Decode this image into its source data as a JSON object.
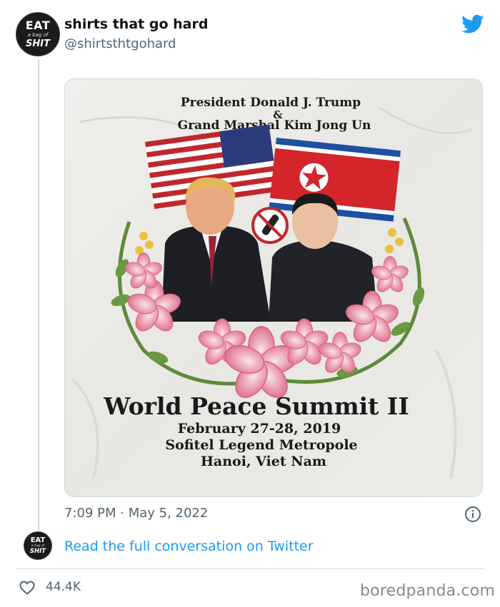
{
  "tweet": {
    "display_name": "shirts that go hard",
    "handle": "@shirtsthtgohard",
    "avatar_text": {
      "line1": "EAT",
      "line2": "a bag of",
      "line3": "SHIT"
    },
    "timestamp": "7:09 PM · May 5, 2022",
    "read_link": "Read the full conversation on Twitter",
    "like_count": "44.4K"
  },
  "photo": {
    "shirt_lines": [
      "President Donald J. Trump",
      "&",
      "Grand Marshal Kim Jong Un",
      "World Peace Summit II",
      "February 27-28, 2019",
      "Sofitel Legend Metropole",
      "Hanoi, Viet Nam"
    ]
  },
  "watermark": "boredpanda.com",
  "colors": {
    "twitter_blue": "#1d9bf0",
    "muted": "#536471",
    "border": "#cfd9de"
  },
  "icons": [
    "twitter-bird-icon",
    "info-icon",
    "heart-icon"
  ]
}
